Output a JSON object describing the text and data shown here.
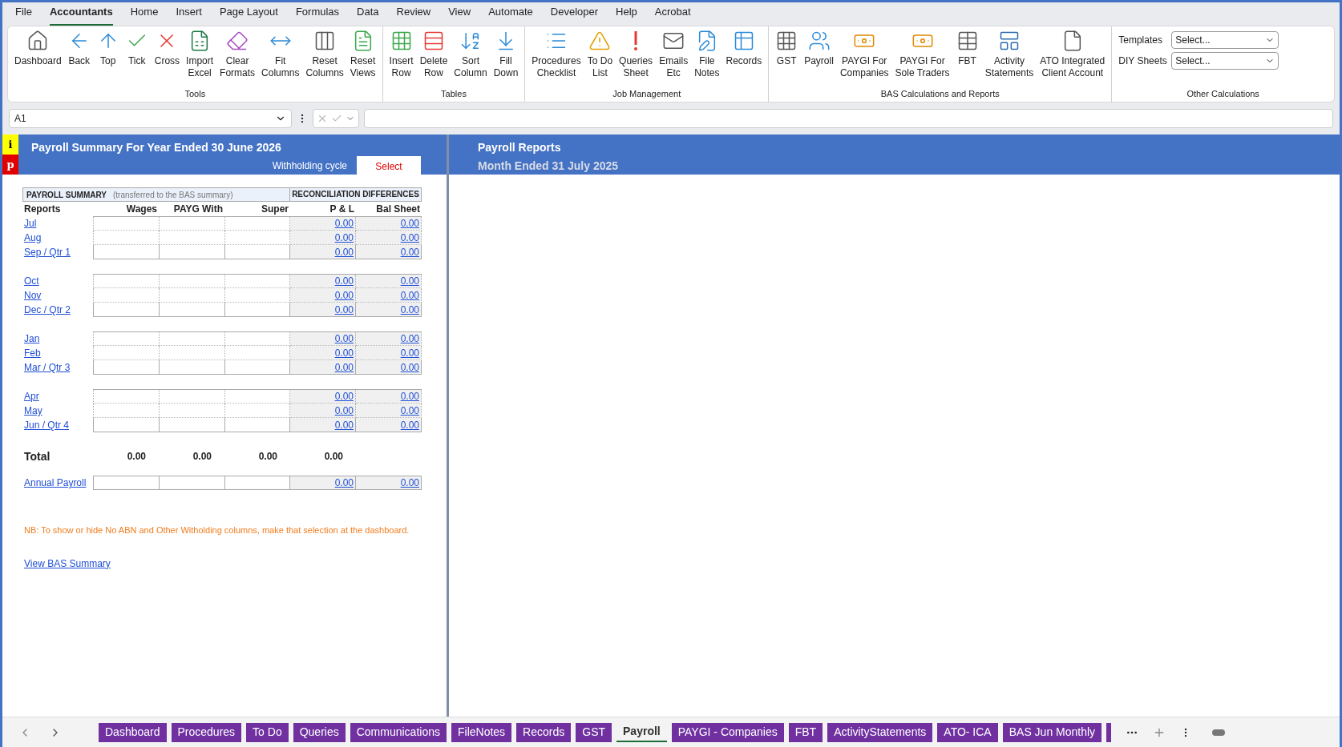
{
  "menu": [
    {
      "label": "File",
      "selected": false
    },
    {
      "label": "Accountants",
      "selected": true
    },
    {
      "label": "Home",
      "selected": false
    },
    {
      "label": "Insert",
      "selected": false
    },
    {
      "label": "Page Layout",
      "selected": false
    },
    {
      "label": "Formulas",
      "selected": false
    },
    {
      "label": "Data",
      "selected": false
    },
    {
      "label": "Review",
      "selected": false
    },
    {
      "label": "View",
      "selected": false
    },
    {
      "label": "Automate",
      "selected": false
    },
    {
      "label": "Developer",
      "selected": false
    },
    {
      "label": "Help",
      "selected": false
    },
    {
      "label": "Acrobat",
      "selected": false
    }
  ],
  "ribbon": [
    {
      "label": "Tools",
      "buttons": [
        [
          "Dashboard"
        ],
        [
          "Back"
        ],
        [
          "Top"
        ],
        [
          "Tick"
        ],
        [
          "Cross"
        ],
        [
          "Import",
          "Excel"
        ],
        [
          "Clear",
          "Formats"
        ],
        [
          "Fit",
          "Columns"
        ],
        [
          "Reset",
          "Columns"
        ],
        [
          "Reset",
          "Views"
        ]
      ]
    },
    {
      "label": "Tables",
      "buttons": [
        [
          "Insert",
          "Row"
        ],
        [
          "Delete",
          "Row"
        ],
        [
          "Sort",
          "Column"
        ],
        [
          "Fill",
          "Down"
        ]
      ]
    },
    {
      "label": "Job Management",
      "buttons": [
        [
          "Procedures",
          "Checklist"
        ],
        [
          "To Do",
          "List"
        ],
        [
          "Queries",
          "Sheet"
        ],
        [
          "Emails",
          "Etc"
        ],
        [
          "File",
          "Notes"
        ],
        [
          "Records"
        ]
      ]
    },
    {
      "label": "BAS Calculations and Reports",
      "buttons": [
        [
          "GST"
        ],
        [
          "Payroll"
        ],
        [
          "PAYGI For",
          "Companies"
        ],
        [
          "PAYGI For",
          "Sole Traders"
        ],
        [
          "FBT"
        ],
        [
          "Activity",
          "Statements"
        ],
        [
          "ATO Integrated",
          "Client Account"
        ]
      ]
    }
  ],
  "other_calculations": {
    "label": "Other Calculations",
    "dropdowns": [
      {
        "label": "Templates",
        "value": "Select..."
      },
      {
        "label": "DIY Sheets",
        "value": "Select..."
      }
    ]
  },
  "formula_bar": {
    "name_box": "A1"
  },
  "left_header": {
    "badges": [
      "i",
      "p"
    ],
    "title": "Payroll Summary For Year Ended 30 June 2026",
    "cycle_label": "Withholding cycle",
    "cycle_value": "Select"
  },
  "right_header": {
    "title": "Payroll Reports",
    "subtitle": "Month Ended 31 July 2025"
  },
  "summary": {
    "title": "PAYROLL SUMMARY",
    "note": "(transferred to the BAS summary)",
    "recon_title": "RECONCILIATION DIFFERENCES",
    "columns": [
      "Reports",
      "Wages",
      "PAYG With",
      "Super",
      "P & L",
      "Bal Sheet"
    ],
    "groups": [
      [
        {
          "label": "Jul",
          "pl": "0.00",
          "bs": "0.00"
        },
        {
          "label": "Aug",
          "pl": "0.00",
          "bs": "0.00"
        },
        {
          "label": "Sep / Qtr 1",
          "pl": "0.00",
          "bs": "0.00"
        }
      ],
      [
        {
          "label": "Oct",
          "pl": "0.00",
          "bs": "0.00"
        },
        {
          "label": "Nov",
          "pl": "0.00",
          "bs": "0.00"
        },
        {
          "label": "Dec / Qtr 2",
          "pl": "0.00",
          "bs": "0.00"
        }
      ],
      [
        {
          "label": "Jan",
          "pl": "0.00",
          "bs": "0.00"
        },
        {
          "label": "Feb",
          "pl": "0.00",
          "bs": "0.00"
        },
        {
          "label": "Mar / Qtr 3",
          "pl": "0.00",
          "bs": "0.00"
        }
      ],
      [
        {
          "label": "Apr",
          "pl": "0.00",
          "bs": "0.00"
        },
        {
          "label": "May",
          "pl": "0.00",
          "bs": "0.00"
        },
        {
          "label": "Jun / Qtr 4",
          "pl": "0.00",
          "bs": "0.00"
        }
      ]
    ],
    "total": {
      "label": "Total",
      "values": [
        "0.00",
        "0.00",
        "0.00",
        "0.00"
      ]
    },
    "annual": {
      "label": "Annual Payroll",
      "pl": "0.00",
      "bs": "0.00"
    },
    "nb": "NB: To show or hide No ABN and Other Witholding columns, make that selection at the dashboard.",
    "link": "View BAS Summary"
  },
  "sheet_tabs": [
    {
      "label": "Dashboard",
      "selected": false
    },
    {
      "label": "Procedures",
      "selected": false
    },
    {
      "label": "To Do",
      "selected": false
    },
    {
      "label": "Queries",
      "selected": false
    },
    {
      "label": "Communications",
      "selected": false
    },
    {
      "label": "FileNotes",
      "selected": false
    },
    {
      "label": "Records",
      "selected": false
    },
    {
      "label": "GST",
      "selected": false
    },
    {
      "label": "Payroll",
      "selected": true
    },
    {
      "label": "PAYGI - Companies",
      "selected": false
    },
    {
      "label": "FBT",
      "selected": false
    },
    {
      "label": "ActivityStatements",
      "selected": false
    },
    {
      "label": "ATO- ICA",
      "selected": false
    },
    {
      "label": "BAS Jun Monthly",
      "selected": false
    }
  ]
}
